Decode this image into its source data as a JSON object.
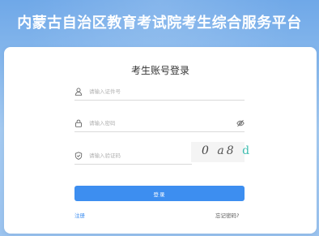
{
  "header": {
    "site_title": "内蒙古自治区教育考试院考生综合服务平台"
  },
  "login_form": {
    "heading": "考生账号登录",
    "id_field": {
      "placeholder": "请输入证件号",
      "value": "",
      "icon": "user-icon"
    },
    "password_field": {
      "placeholder": "请输入密码",
      "value": "",
      "icon": "lock-icon",
      "toggle_icon": "eye-hidden-icon"
    },
    "captcha_field": {
      "placeholder": "请输入验证码",
      "value": "",
      "icon": "shield-icon"
    },
    "captcha_image": {
      "chars": [
        "0",
        "a8",
        "d"
      ]
    },
    "submit_label": "登录",
    "register_link": "注册",
    "forgot_link": "忘记密码?"
  },
  "colors": {
    "accent": "#3d8ef0",
    "background_top": "#6fa8e8",
    "background_bottom": "#9cc4ef",
    "card": "#ffffff",
    "captcha_accent": "#3dbdb0"
  }
}
